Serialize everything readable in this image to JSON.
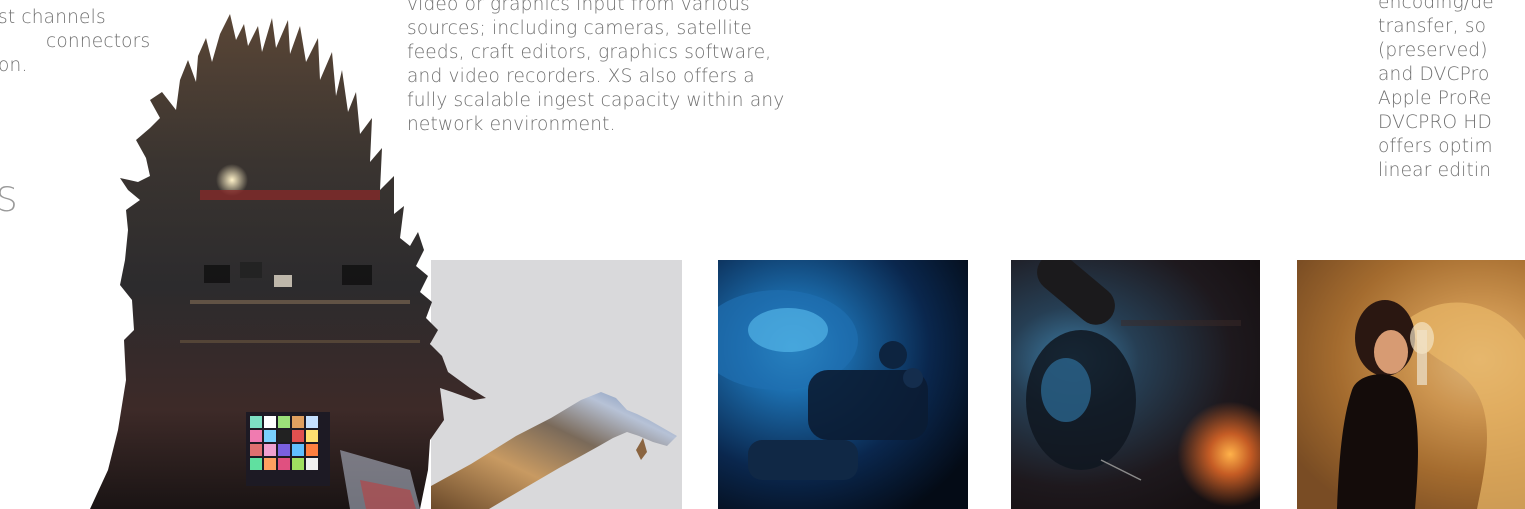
{
  "left_text": {
    "lines": [
      "st channels",
      "connectors",
      "on."
    ]
  },
  "section_heading": "S",
  "middle_text": {
    "lines": [
      "video or graphics input from various",
      "sources; including cameras, satellite",
      "feeds, craft editors, graphics software,",
      "and video recorders. XS also offers a",
      "fully scalable ingest capacity within any",
      "network environment."
    ]
  },
  "right_text": {
    "lines": [
      "encoding/de",
      "transfer, so",
      "(preserved)",
      "and DVCPro",
      "Apple ProRe",
      "DVCPRO HD",
      "offers optim",
      "linear editin"
    ]
  },
  "photos": [
    {
      "icon": "studio-silhouette-collage-image"
    },
    {
      "icon": "hand-silhouette-collage-image"
    },
    {
      "icon": "camera-closeup-image"
    },
    {
      "icon": "microphone-camera-image"
    },
    {
      "icon": "woman-with-wine-glass-image"
    }
  ],
  "colors": {
    "body_text": "#707070",
    "heading_text": "#9a9a9a",
    "grey_panel": "#d9d9db",
    "blue_tone": "#1e78be",
    "warm_tone": "#d9a25a"
  }
}
